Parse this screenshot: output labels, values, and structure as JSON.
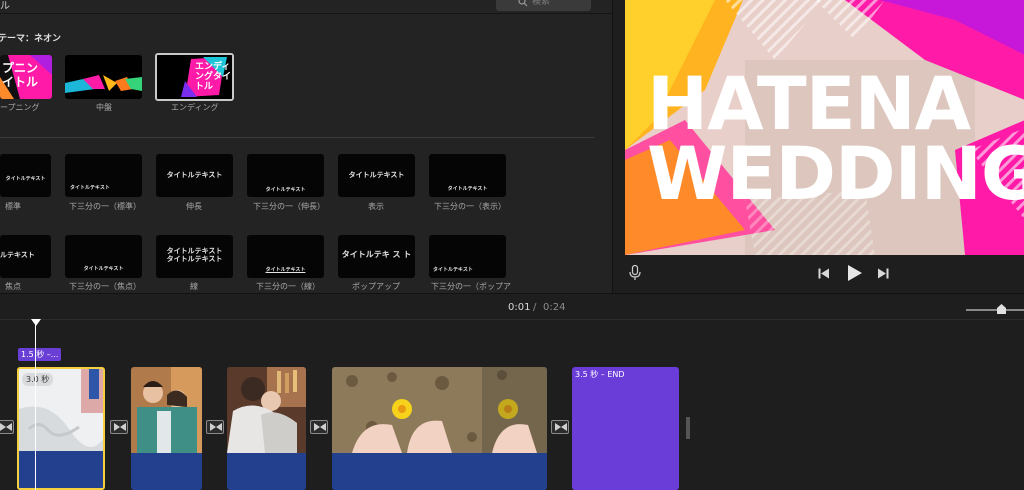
{
  "browser": {
    "title": "ル",
    "search_placeholder": "検索",
    "theme_label": "テーマ：ネオン",
    "theme_items": [
      {
        "label": "ープニング",
        "thumb_text": "プニン\nイトル"
      },
      {
        "label": "中盤",
        "thumb_text": ""
      },
      {
        "label": "エンディング",
        "thumb_text": "エンディ\nングタイ\nトル"
      }
    ],
    "title_items_row1": [
      {
        "label": "標準",
        "thumb_text": "タイトルテキスト"
      },
      {
        "label": "下三分の一（標準）",
        "thumb_text": "タイトルテキスト"
      },
      {
        "label": "伸長",
        "thumb_text": "タイトルテキスト"
      },
      {
        "label": "下三分の一（伸長）",
        "thumb_text": "タイトルテキスト"
      },
      {
        "label": "表示",
        "thumb_text": "タイトルテキスト"
      },
      {
        "label": "下三分の一（表示）",
        "thumb_text": "タイトルテキスト"
      }
    ],
    "title_items_row2": [
      {
        "label": "焦点",
        "thumb_text": "ルテキスト"
      },
      {
        "label": "下三分の一（焦点）",
        "thumb_text": "タイトルテキスト"
      },
      {
        "label": "線",
        "thumb_text": "タイトルテキスト\nタイトルテキスト"
      },
      {
        "label": "下三分の一（線）",
        "thumb_text": "タイトルテキスト"
      },
      {
        "label": "ポップアップ",
        "thumb_text": "タイトルテキ ス ト"
      },
      {
        "label": "下三分の一（ポップア",
        "thumb_text": "タイトルテキスト"
      }
    ]
  },
  "viewer": {
    "preview_line1": "HATENA",
    "preview_line2": "WEDDING"
  },
  "timeline": {
    "current_time": "0:01",
    "separator": "/",
    "total_time": "0:24",
    "title_tag": "1.5 秒 –...",
    "duration_badge": "3.0 秒",
    "end_clip_label": "3.5 秒 – END"
  },
  "colors": {
    "accent_purple": "#6a3cd8",
    "audio_blue": "#23408f",
    "selection_yellow": "#f4d03f",
    "neon_pink": "#ff1aa8",
    "neon_orange": "#ff9a1f"
  }
}
